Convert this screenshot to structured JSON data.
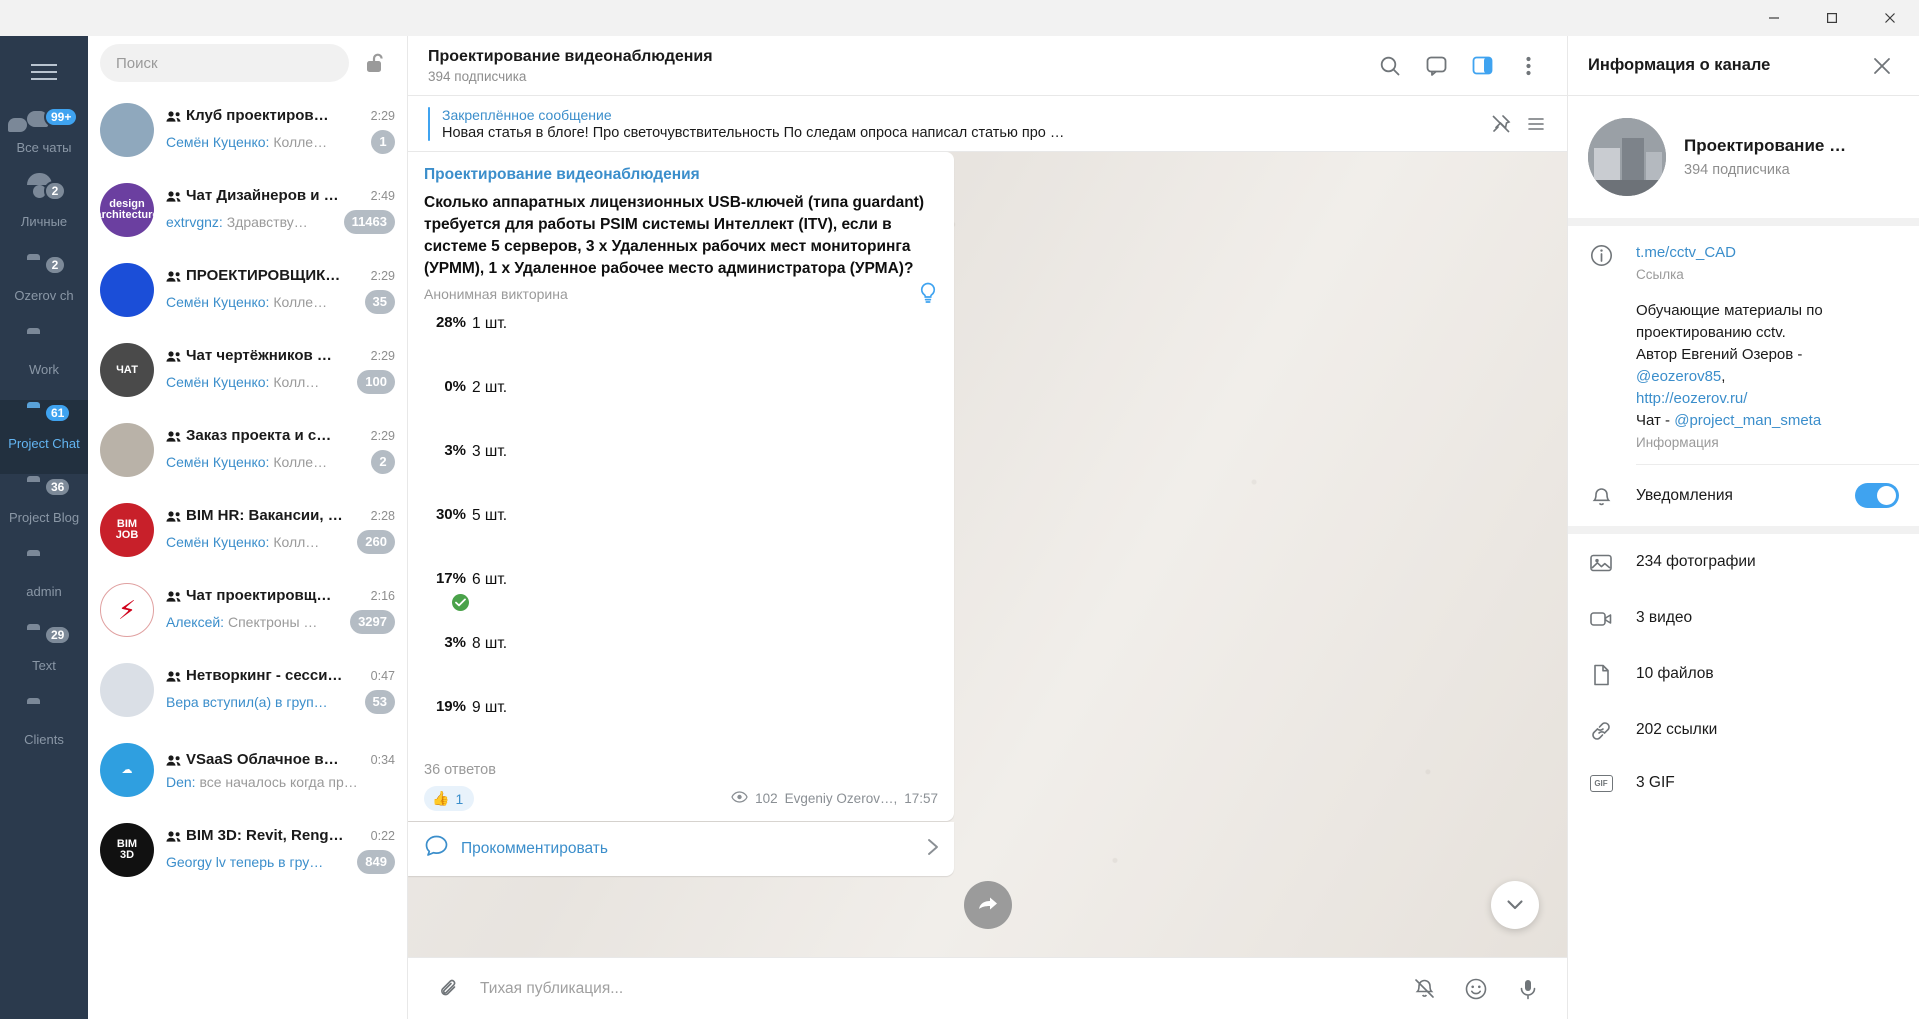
{
  "titlebar": {
    "minimize": "—",
    "maximize": "▢",
    "close": "✕"
  },
  "rail": {
    "menu_label": "menu",
    "folders": [
      {
        "name": "Все чаты",
        "badge": "99+",
        "icon": "chats-icon",
        "active": false,
        "blue_badge": true
      },
      {
        "name": "Личные",
        "badge": "2",
        "icon": "person-icon",
        "active": false,
        "blue_badge": false
      },
      {
        "name": "Ozerov ch",
        "badge": "2",
        "icon": "folder-icon",
        "active": false,
        "blue_badge": false
      },
      {
        "name": "Work",
        "badge": "",
        "icon": "folder-icon",
        "active": false,
        "blue_badge": false
      },
      {
        "name": "Project Chat",
        "badge": "61",
        "icon": "folder-icon",
        "active": true,
        "blue_badge": true
      },
      {
        "name": "Project Blog",
        "badge": "36",
        "icon": "folder-icon",
        "active": false,
        "blue_badge": false
      },
      {
        "name": "admin",
        "badge": "",
        "icon": "folder-icon",
        "active": false,
        "blue_badge": false
      },
      {
        "name": "Text",
        "badge": "29",
        "icon": "folder-icon",
        "active": false,
        "blue_badge": false
      },
      {
        "name": "Clients",
        "badge": "",
        "icon": "folder-icon",
        "active": false,
        "blue_badge": false
      }
    ]
  },
  "search": {
    "placeholder": "Поиск",
    "lock_icon": "unlock-icon"
  },
  "chats": [
    {
      "title": "Клуб проектиров…",
      "time": "2:29",
      "sender": "Семён Куценко:",
      "preview": "Колле…",
      "badge": "1",
      "avatar_text": "",
      "avatar_bg": "#8fa8bd"
    },
    {
      "title": "Чат Дизайнеров и …",
      "time": "2:49",
      "sender": "extrvgnz:",
      "preview": "Здравству…",
      "badge": "11463",
      "avatar_text": "design\narchitecture",
      "avatar_bg": "#6b3fa0"
    },
    {
      "title": "ПРОЕКТИРОВЩИК…",
      "time": "2:29",
      "sender": "Семён Куценко:",
      "preview": "Колле…",
      "badge": "35",
      "avatar_text": "",
      "avatar_bg": "#1b4ed8"
    },
    {
      "title": "Чат чертёжников …",
      "time": "2:29",
      "sender": "Семён Куценко:",
      "preview": "Колл…",
      "badge": "100",
      "avatar_text": "ЧАТ",
      "avatar_bg": "#4a4a4a"
    },
    {
      "title": "Заказ проекта и с…",
      "time": "2:29",
      "sender": "Семён Куценко:",
      "preview": "Колле…",
      "badge": "2",
      "avatar_text": "",
      "avatar_bg": "#b9b2a8"
    },
    {
      "title": "BIM HR: Вакансии, …",
      "time": "2:28",
      "sender": "Семён Куценко:",
      "preview": "Колл…",
      "badge": "260",
      "avatar_text": "BIM\nJOB",
      "avatar_bg": "#c8202a"
    },
    {
      "title": "Чат проектировщ…",
      "time": "2:16",
      "sender": "Алексей:",
      "preview": "Спектроны …",
      "badge": "3297",
      "avatar_text": "⚡",
      "avatar_bg": "#ffffff"
    },
    {
      "title": "Нетворкинг - сесси…",
      "time": "0:47",
      "sender": "Вера вступил(а) в груп…",
      "preview": "",
      "badge": "53",
      "avatar_text": "",
      "avatar_bg": "#dadfe6"
    },
    {
      "title": "VSaaS Облачное в…",
      "time": "0:34",
      "sender": "Den:",
      "preview": "все началось когда пр…",
      "badge": "",
      "avatar_text": "☁",
      "avatar_bg": "#2f9fe0"
    },
    {
      "title": "BIM 3D: Revit, Reng…",
      "time": "0:22",
      "sender": "Georgy lv теперь в гру…",
      "preview": "",
      "badge": "849",
      "avatar_text": "BIM\n3D",
      "avatar_bg": "#111111"
    }
  ],
  "chat_header": {
    "title": "Проектирование видеонаблюдения",
    "subtitle": "394 подписчика",
    "icons": [
      "search-icon",
      "comments-icon",
      "info-panel-icon",
      "more-vertical-icon"
    ]
  },
  "pinned": {
    "label": "Закреплённое сообщение",
    "preview": "Новая статья в блоге! Про светочувствительность  По следам опроса написал статью про …",
    "unpin_icon": "unpin-icon",
    "list_icon": "pin-list-icon"
  },
  "message": {
    "author": "Проектирование видеонаблюдения",
    "poll_type": "Анонимная викторина",
    "bulb_icon": "lightbulb-icon",
    "total_answers": "36 ответов",
    "reaction_emoji": "👍",
    "reaction_count": "1",
    "views_icon": "eye-icon",
    "views": "102",
    "signature": "Evgeniy Ozerov…,",
    "time": "17:57",
    "comment_label": "Прокомментировать",
    "comment_icon": "comment-bubble-icon",
    "comment_chevron": "chevron-right-icon"
  },
  "chart_data": {
    "type": "bar",
    "title": "Сколько аппаратных лицензионных USB-ключей (типа guardant) требуется для работы PSIM системы Интеллект (ITV), если в системе 5 серверов, 3 х Удаленных рабочих мест мониторинга (УРММ), 1 х Удаленное рабочее место администратора (УРМА)?",
    "subtitle": "Анонимная викторина",
    "xlabel": "",
    "ylabel": "",
    "ylim": [
      0,
      100
    ],
    "grid": false,
    "legend": "none",
    "categories": [
      "1 шт.",
      "2 шт.",
      "3 шт.",
      "5 шт.",
      "6 шт.",
      "8 шт.",
      "9 шт."
    ],
    "values": [
      28,
      0,
      3,
      30,
      17,
      3,
      19
    ],
    "value_labels": [
      "28%",
      "0%",
      "3%",
      "30%",
      "17%",
      "3%",
      "19%"
    ],
    "correct_index": 4,
    "bar_color": "#4aa3dd",
    "correct_color": "#4aa24a",
    "annotations": [
      "36 ответов"
    ]
  },
  "composer": {
    "placeholder": "Тихая публикация...",
    "attach_icon": "paperclip-icon",
    "mute_icon": "bell-off-icon",
    "emoji_icon": "smile-icon",
    "mic_icon": "microphone-icon"
  },
  "info_panel": {
    "title": "Информация о канале",
    "close_icon": "close-icon",
    "profile_name": "Проектирование …",
    "profile_sub": "394 подписчика",
    "link": "t.me/cctv_CAD",
    "link_caption": "Ссылка",
    "link_icon": "info-circle-icon",
    "description_lines": [
      "Обучающие материалы по",
      "проектированию cctv.",
      "Автор Евгений Озеров -"
    ],
    "description_link1": "@eozerov85",
    "description_comma": ",",
    "description_link2": "http://eozerov.ru/",
    "description_chat_prefix": "Чат - ",
    "description_link3": "@project_man_smeta",
    "description_caption": "Информация",
    "notifications_label": "Уведомления",
    "notifications_on": true,
    "bell_icon": "bell-icon",
    "media": [
      {
        "label": "234 фотографии",
        "icon": "photo-icon"
      },
      {
        "label": "3 видео",
        "icon": "video-icon"
      },
      {
        "label": "10 файлов",
        "icon": "file-icon"
      },
      {
        "label": "202 ссылки",
        "icon": "link-icon"
      },
      {
        "label": "3 GIF",
        "icon": "gif-icon"
      }
    ]
  },
  "colors": {
    "accent": "#3fa3f0",
    "correct": "#4aa24a",
    "rail_bg": "#2b3a4d",
    "poll_bar": "#4aa3dd"
  }
}
